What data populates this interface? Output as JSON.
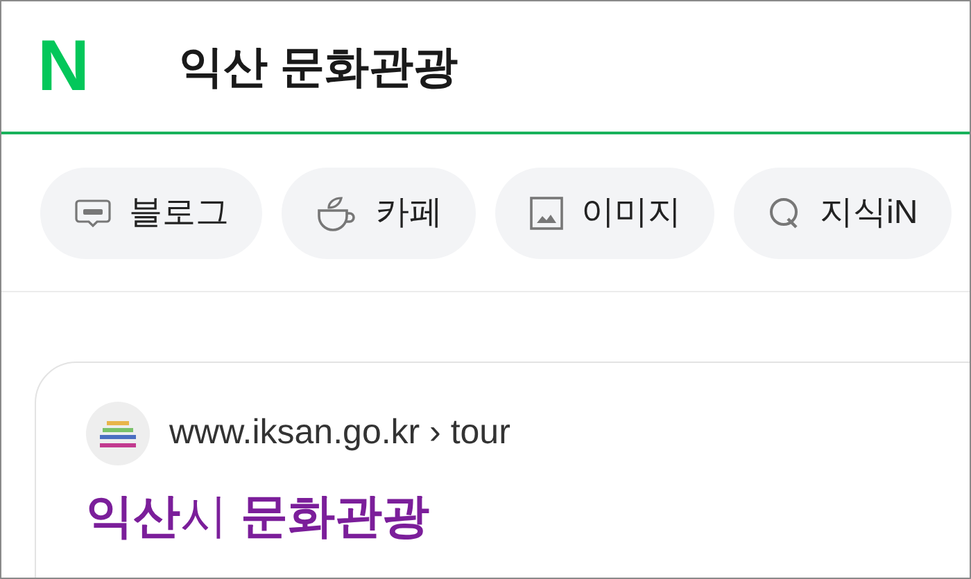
{
  "header": {
    "logo": "N",
    "query": "익산 문화관광"
  },
  "tabs": [
    {
      "kind": "blog",
      "label": "블로그"
    },
    {
      "kind": "cafe",
      "label": "카페"
    },
    {
      "kind": "image",
      "label": "이미지"
    },
    {
      "kind": "kin",
      "label": "지식iN"
    }
  ],
  "result": {
    "url": "www.iksan.go.kr › tour",
    "title": "**익산**시 **문화관광**"
  }
}
